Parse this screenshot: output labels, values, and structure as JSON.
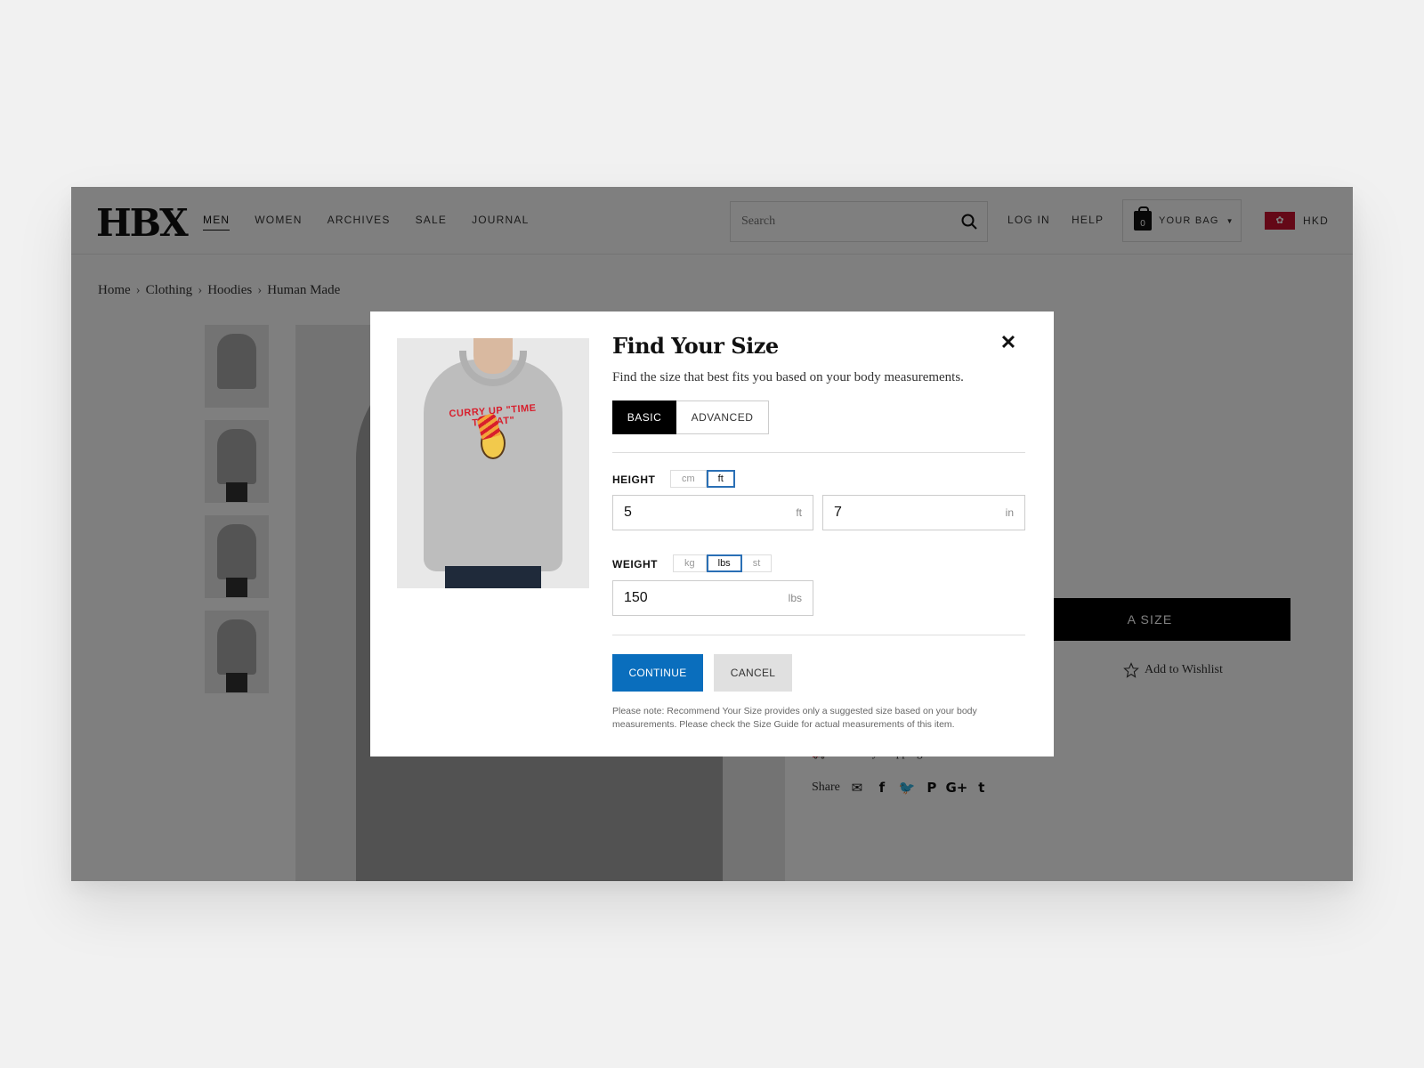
{
  "header": {
    "logo": "HBX",
    "nav": [
      "MEN",
      "WOMEN",
      "ARCHIVES",
      "SALE",
      "JOURNAL"
    ],
    "active_nav": "MEN",
    "search_placeholder": "Search",
    "login": "LOG IN",
    "help": "HELP",
    "bag_count": "0",
    "bag_label": "YOUR BAG",
    "currency": "HKD"
  },
  "breadcrumb": [
    "Home",
    "Clothing",
    "Hoodies",
    "Human Made"
  ],
  "product": {
    "select_size_label": "A SIZE",
    "wishlist_label": "Add to Wishlist",
    "shipping_label": "Same-Day Shipping",
    "share_label": "Share"
  },
  "modal": {
    "title": "Find Your Size",
    "subtitle": "Find the size that best fits you based on your body measurements.",
    "tabs": {
      "basic": "BASIC",
      "advanced": "ADVANCED"
    },
    "image_print_text": "CURRY UP \"TIME TO EAT\"",
    "height": {
      "label": "HEIGHT",
      "units": [
        "cm",
        "ft"
      ],
      "active_unit": "ft",
      "feet_value": "5",
      "feet_suffix": "ft",
      "inches_value": "7",
      "inches_suffix": "in"
    },
    "weight": {
      "label": "WEIGHT",
      "units": [
        "kg",
        "lbs",
        "st"
      ],
      "active_unit": "lbs",
      "value": "150",
      "suffix": "lbs"
    },
    "continue_label": "CONTINUE",
    "cancel_label": "CANCEL",
    "note": "Please note: Recommend Your Size provides only a suggested size based on your body measurements. Please check the Size Guide for actual measurements of this item."
  },
  "colors": {
    "overlay": "rgba(0,0,0,0.5)",
    "primary_button": "#0a6ebd",
    "active_unit_border": "#2a6fb5",
    "flag": "#c8102e"
  }
}
